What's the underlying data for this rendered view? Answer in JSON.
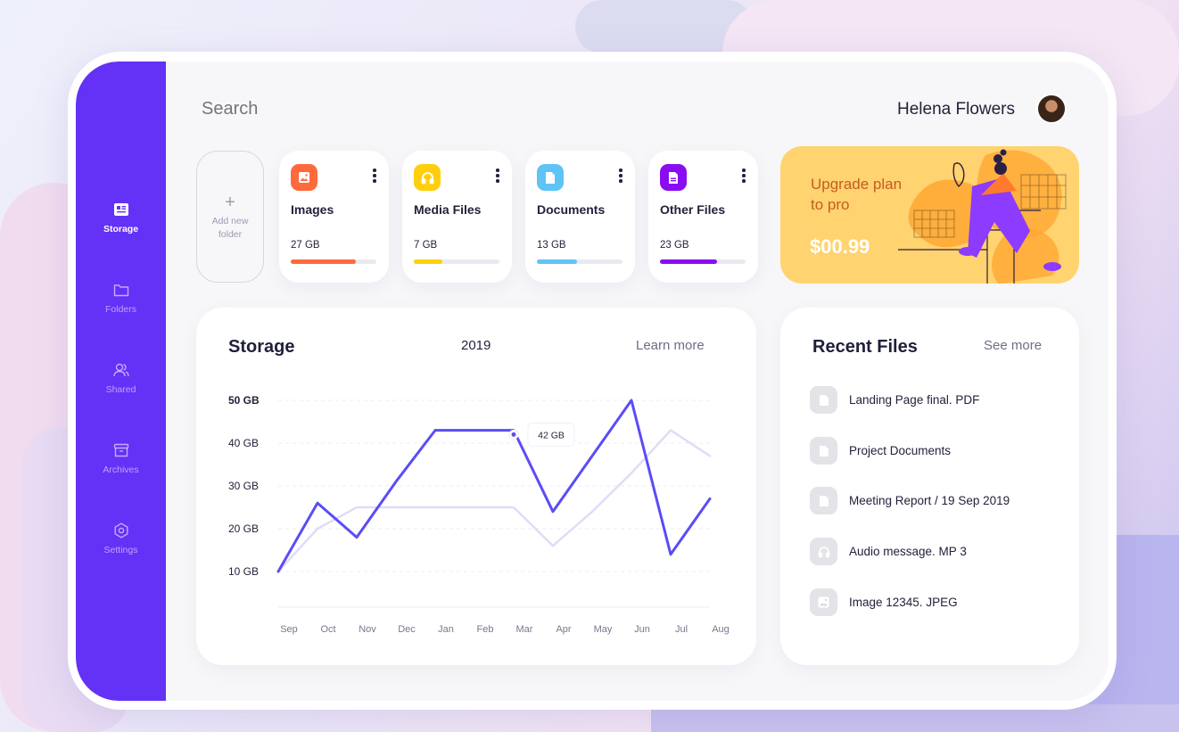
{
  "search": {
    "placeholder": "Search"
  },
  "user": {
    "name": "Helena Flowers"
  },
  "sidebar": {
    "items": [
      {
        "label": "Storage",
        "icon": "storage-icon",
        "active": true
      },
      {
        "label": "Folders",
        "icon": "folder-icon",
        "active": false
      },
      {
        "label": "Shared",
        "icon": "users-icon",
        "active": false
      },
      {
        "label": "Archives",
        "icon": "archive-icon",
        "active": false
      },
      {
        "label": "Settings",
        "icon": "gear-icon",
        "active": false
      }
    ]
  },
  "add_folder": {
    "label": "Add new folder",
    "icon": "plus-icon"
  },
  "categories": [
    {
      "label": "Images",
      "size": "27 GB",
      "usage": 0.76,
      "color": "#ff6a3d",
      "icon": "image-icon"
    },
    {
      "label": "Media Files",
      "size": "7 GB",
      "usage": 0.33,
      "color": "#ffcf0d",
      "icon": "headphones-icon"
    },
    {
      "label": "Documents",
      "size": "13 GB",
      "usage": 0.47,
      "color": "#5ec4f5",
      "icon": "document-icon"
    },
    {
      "label": "Other Files",
      "size": "23 GB",
      "usage": 0.67,
      "color": "#8a0df2",
      "icon": "file-icon"
    }
  ],
  "promo": {
    "title": "Upgrade plan to pro",
    "price": "$00.99",
    "illustration": "person-climbing-stairs-illustration"
  },
  "storage": {
    "title": "Storage",
    "year": "2019",
    "link": "Learn more"
  },
  "chart_data": {
    "type": "line",
    "x": [
      "Sep",
      "Oct",
      "Nov",
      "Dec",
      "Jan",
      "Feb",
      "Mar",
      "Apr",
      "May",
      "Jun",
      "Jul",
      "Aug"
    ],
    "y_ticks": [
      "50 GB",
      "40 GB",
      "30 GB",
      "20 GB",
      "10 GB"
    ],
    "ylim": [
      10,
      50
    ],
    "grid": true,
    "series": [
      {
        "values": [
          10,
          26,
          18,
          31,
          43,
          43,
          43,
          24,
          37,
          50,
          14,
          27
        ],
        "color": "#5b4cf6"
      },
      {
        "values": [
          10,
          20,
          25,
          25,
          25,
          25,
          25,
          16,
          24,
          33,
          43,
          37
        ],
        "color": "#e0dcf7"
      }
    ],
    "annotation": {
      "x": "Mar",
      "value": 42,
      "label": "42 GB"
    }
  },
  "recent": {
    "title": "Recent Files",
    "link": "See more",
    "files": [
      {
        "name": "Landing Page final. PDF",
        "icon": "document-icon"
      },
      {
        "name": "Project Documents",
        "icon": "document-icon"
      },
      {
        "name": "Meeting Report / 19 Sep 2019",
        "icon": "document-icon"
      },
      {
        "name": "Audio message. MP 3",
        "icon": "headphones-icon"
      },
      {
        "name": "Image 12345. JPEG",
        "icon": "image-icon"
      }
    ]
  }
}
